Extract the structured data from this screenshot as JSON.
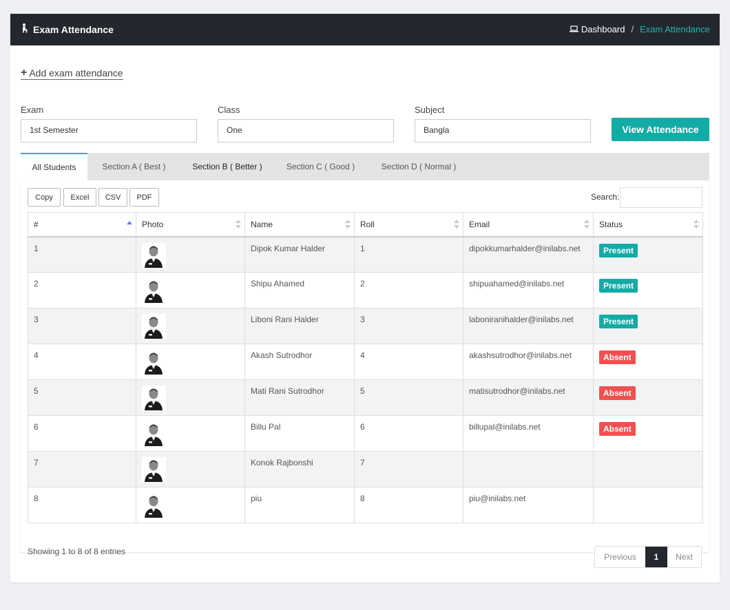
{
  "header": {
    "title": "Exam Attendance",
    "breadcrumb": {
      "home": "Dashboard",
      "separator": "/",
      "current": "Exam Attendance"
    }
  },
  "add_link": {
    "label": "Add exam attendance"
  },
  "filters": {
    "exam": {
      "label": "Exam",
      "value": "1st Semester"
    },
    "class": {
      "label": "Class",
      "value": "One"
    },
    "subject": {
      "label": "Subject",
      "value": "Bangla"
    },
    "button": "View Attendance"
  },
  "tabs": [
    {
      "label": "All Students"
    },
    {
      "label": "Section A ( Best )"
    },
    {
      "label": "Section B ( Better )"
    },
    {
      "label": "Section C ( Good )"
    },
    {
      "label": "Section D ( Normal )"
    }
  ],
  "export_buttons": [
    "Copy",
    "Excel",
    "CSV",
    "PDF"
  ],
  "search": {
    "label": "Search:",
    "value": ""
  },
  "table": {
    "columns": [
      "#",
      "Photo",
      "Name",
      "Roll",
      "Email",
      "Status"
    ],
    "rows": [
      {
        "num": "1",
        "name": "Dipok Kumar Halder",
        "roll": "1",
        "email": "dipokkumarhalder@inilabs.net",
        "status": "Present"
      },
      {
        "num": "2",
        "name": "Shipu Ahamed",
        "roll": "2",
        "email": "shipuahamed@inilabs.net",
        "status": "Present"
      },
      {
        "num": "3",
        "name": "Liboni Rani Halder",
        "roll": "3",
        "email": "laboniranihalder@inilabs.net",
        "status": "Present"
      },
      {
        "num": "4",
        "name": "Akash Sutrodhor",
        "roll": "4",
        "email": "akashsutrodhor@inilabs.net",
        "status": "Absent"
      },
      {
        "num": "5",
        "name": "Mati Rani Sutrodhor",
        "roll": "5",
        "email": "matisutrodhor@inilabs.net",
        "status": "Absent"
      },
      {
        "num": "6",
        "name": "Billu Pal",
        "roll": "6",
        "email": "billupal@inilabs.net",
        "status": "Absent"
      },
      {
        "num": "7",
        "name": "Konok Rajbonshi",
        "roll": "7",
        "email": "",
        "status": ""
      },
      {
        "num": "8",
        "name": "piu",
        "roll": "8",
        "email": "piu@inilabs.net",
        "status": ""
      }
    ]
  },
  "info": "Showing 1 to 8 of 8 entries",
  "pagination": {
    "previous": "Previous",
    "current": "1",
    "next": "Next"
  },
  "colors": {
    "header_bg": "#23272e",
    "accent": "#13aba5",
    "present": "#13aba5",
    "absent": "#f0504f"
  },
  "icons": {
    "title": "user-seated-icon",
    "breadcrumb": "laptop-icon",
    "add": "plus-icon",
    "photo": "user-avatar-icon"
  }
}
